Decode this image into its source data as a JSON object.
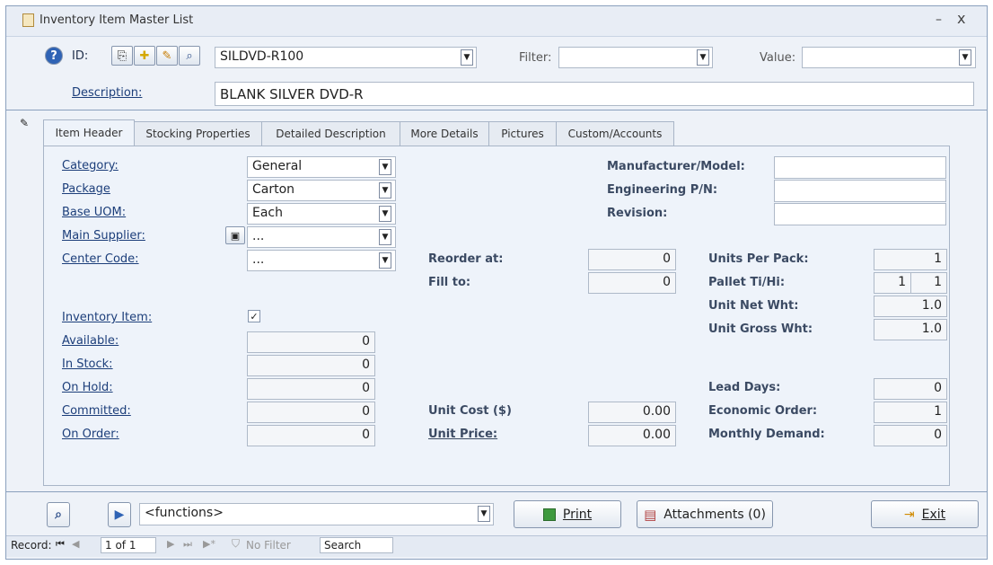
{
  "window": {
    "title": "Inventory Item Master List"
  },
  "header": {
    "id_label": "ID:",
    "id_value": "SILDVD-R100",
    "filter_label": "Filter:",
    "filter_value": "",
    "value_label": "Value:",
    "value_value": "",
    "description_label": "Description:",
    "description_value": "BLANK SILVER DVD-R"
  },
  "tabs": [
    {
      "label": "Item Header"
    },
    {
      "label": "Stocking Properties"
    },
    {
      "label": "Detailed Description"
    },
    {
      "label": "More Details"
    },
    {
      "label": "Pictures"
    },
    {
      "label": "Custom/Accounts"
    }
  ],
  "left_fields": {
    "category_label": "Category:",
    "category_value": "General",
    "package_label": "Package",
    "package_value": "Carton",
    "base_uom_label": "Base UOM:",
    "base_uom_value": "Each",
    "main_supplier_label": "Main Supplier:",
    "main_supplier_value": "...",
    "center_code_label": "Center Code:",
    "center_code_value": "..."
  },
  "inventory": {
    "inventory_item_label": "Inventory Item:",
    "inventory_item_checked": "✓",
    "available_label": "Available:",
    "available_value": "0",
    "in_stock_label": "In Stock:",
    "in_stock_value": "0",
    "on_hold_label": "On Hold:",
    "on_hold_value": "0",
    "committed_label": "Committed:",
    "committed_value": "0",
    "on_order_label": "On Order:",
    "on_order_value": "0"
  },
  "middle_fields": {
    "reorder_label": "Reorder at:",
    "reorder_value": "0",
    "fill_label": "Fill to:",
    "fill_value": "0",
    "unit_cost_label": "Unit Cost ($)",
    "unit_cost_value": "0.00",
    "unit_price_label": "Unit Price:",
    "unit_price_value": "0.00"
  },
  "right_fields": {
    "manufacturer_label": "Manufacturer/Model:",
    "manufacturer_value": "",
    "engineering_label": "Engineering P/N:",
    "engineering_value": "",
    "revision_label": "Revision:",
    "revision_value": "",
    "units_per_pack_label": "Units Per Pack:",
    "units_per_pack_value": "1",
    "pallet_label": "Pallet Ti/Hi:",
    "pallet_ti_value": "1",
    "pallet_hi_value": "1",
    "unit_net_label": "Unit Net Wht:",
    "unit_net_value": "1.0",
    "unit_gross_label": "Unit Gross Wht:",
    "unit_gross_value": "1.0",
    "lead_days_label": "Lead Days:",
    "lead_days_value": "0",
    "economic_order_label": "Economic Order:",
    "economic_order_value": "1",
    "monthly_demand_label": "Monthly Demand:",
    "monthly_demand_value": "0"
  },
  "footer": {
    "functions_value": "<functions>",
    "print_label": "Print",
    "attachments_label": "Attachments (0)",
    "exit_label": "Exit"
  },
  "status": {
    "record_label": "Record:",
    "record_value": "1 of 1",
    "no_filter_label": "No Filter",
    "search_label": "Search"
  }
}
